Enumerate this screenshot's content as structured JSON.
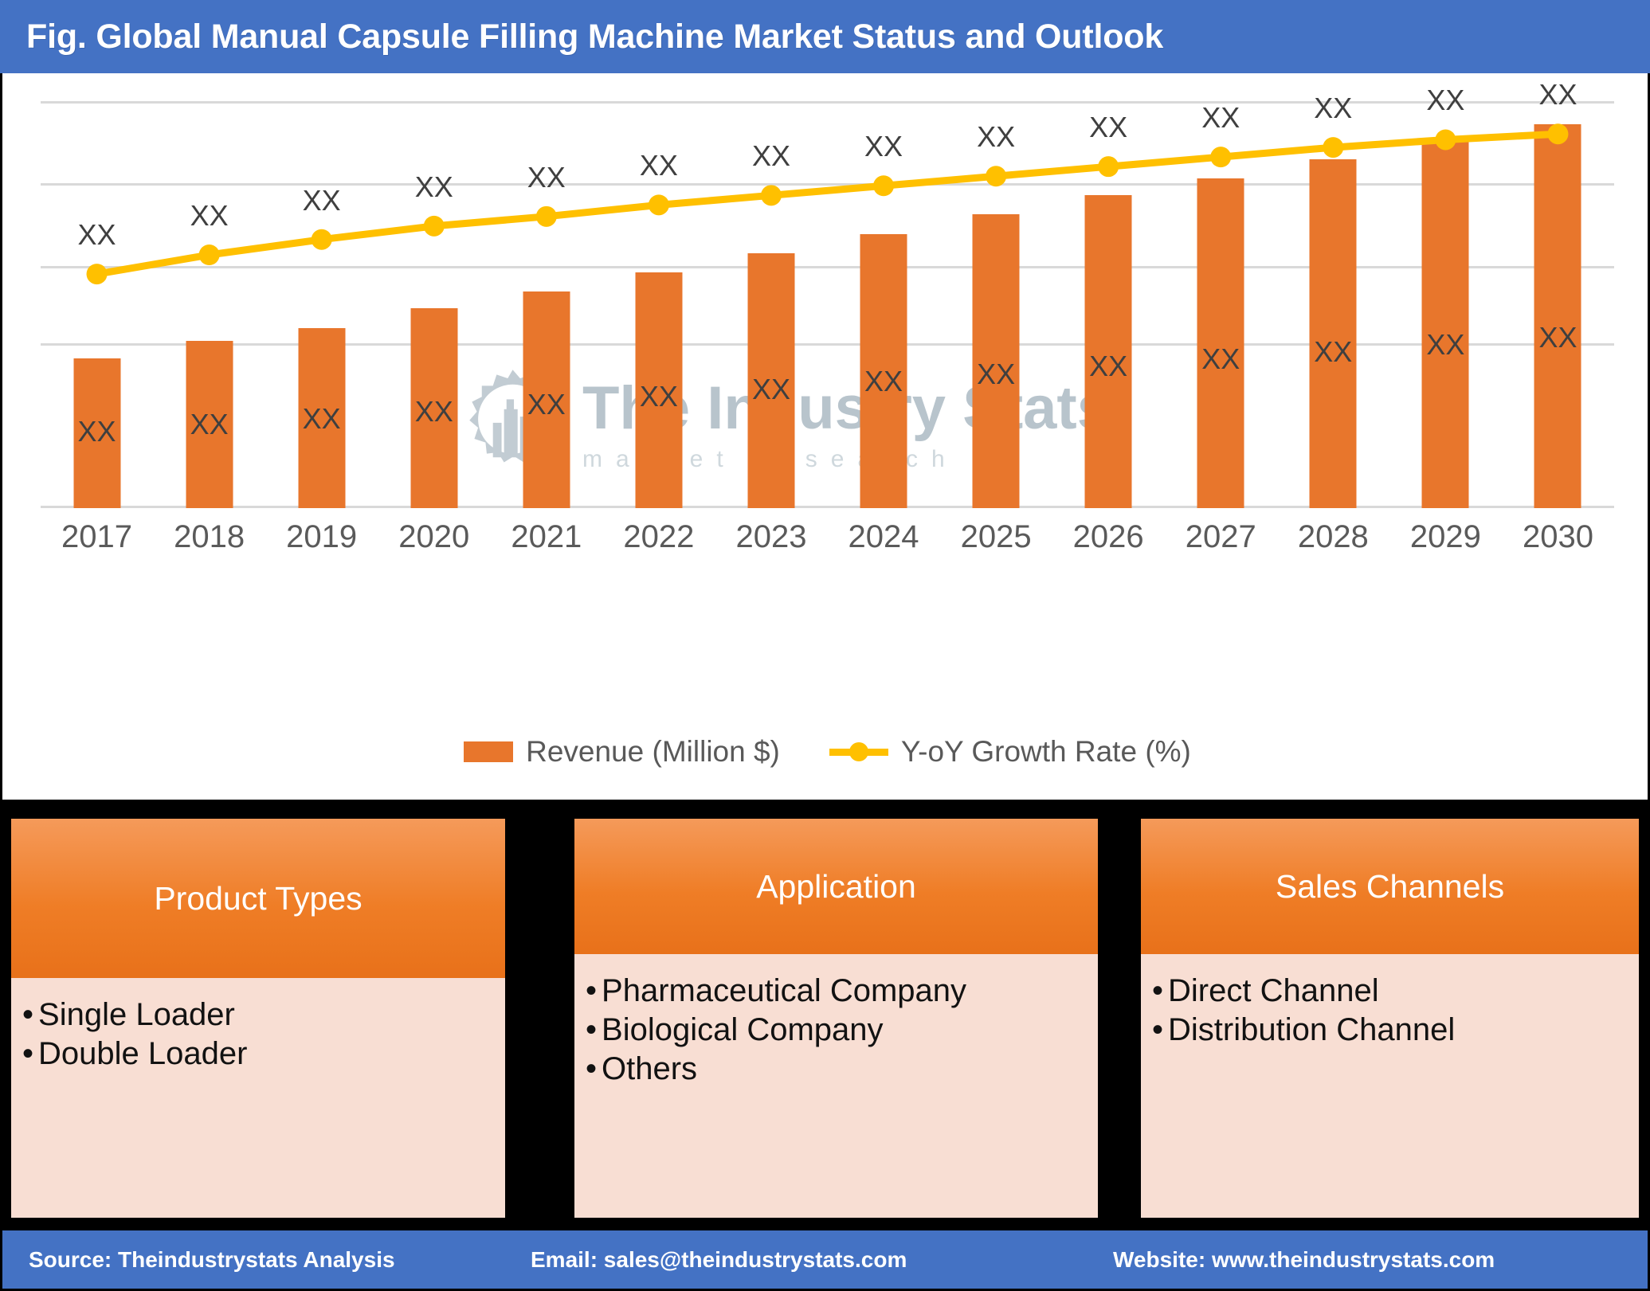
{
  "header": {
    "title": "Fig. Global Manual Capsule Filling Machine Market Status and Outlook",
    "bar_color": "#4472C4"
  },
  "chart_data": {
    "type": "bar",
    "title": "Fig. Global Manual Capsule Filling Machine Market Status and Outlook",
    "xlabel": "",
    "ylabel": "",
    "grid": true,
    "legend_position": "bottom",
    "categories": [
      "2017",
      "2018",
      "2019",
      "2020",
      "2021",
      "2022",
      "2023",
      "2024",
      "2025",
      "2026",
      "2027",
      "2028",
      "2029",
      "2030"
    ],
    "series": [
      {
        "name": "Revenue (Million $)",
        "type": "bar",
        "color": "#E8762C",
        "values": [
          39.0,
          43.5,
          47.0,
          52.0,
          56.5,
          61.5,
          66.5,
          71.5,
          76.5,
          81.5,
          86.0,
          91.0,
          95.5,
          100.0
        ],
        "point_labels": [
          "XX",
          "XX",
          "XX",
          "XX",
          "XX",
          "XX",
          "XX",
          "XX",
          "XX",
          "XX",
          "XX",
          "XX",
          "XX",
          "XX"
        ]
      },
      {
        "name": "Y-oY Growth Rate (%)",
        "type": "line",
        "color": "#FFC000",
        "values": [
          61.0,
          66.0,
          70.0,
          73.5,
          76.0,
          79.0,
          81.5,
          84.0,
          86.5,
          89.0,
          91.5,
          94.0,
          96.0,
          97.5
        ],
        "point_labels": [
          "XX",
          "XX",
          "XX",
          "XX",
          "XX",
          "XX",
          "XX",
          "XX",
          "XX",
          "XX",
          "XX",
          "XX",
          "XX",
          "XX"
        ]
      }
    ],
    "ylim": [
      0,
      110
    ],
    "gridline_values": [
      103.5,
      84.0,
      64.5,
      45.0,
      0
    ],
    "axis_tick_labels": [
      "2017",
      "2018",
      "2019",
      "2020",
      "2021",
      "2022",
      "2023",
      "2024",
      "2025",
      "2026",
      "2027",
      "2028",
      "2029",
      "2030"
    ],
    "note": "Values are obfuscated in the source figure; every data label is rendered as the placeholder 'XX'."
  },
  "legend": {
    "items": [
      {
        "label": "Revenue (Million $)",
        "marker": "square",
        "color": "#E8762C"
      },
      {
        "label": "Y-oY Growth Rate (%)",
        "marker": "line-dot",
        "color": "#FFC000"
      }
    ]
  },
  "watermark": {
    "title": "The Industry Stats",
    "subtitle": "market research",
    "logo_name": "gear-wrench-factory-logo"
  },
  "cards": [
    {
      "title": "Product Types",
      "items": [
        "Single Loader",
        "Double Loader"
      ]
    },
    {
      "title": "Application",
      "items": [
        "Pharmaceutical Company",
        "Biological Company",
        "Others"
      ]
    },
    {
      "title": "Sales Channels",
      "items": [
        "Direct Channel",
        "Distribution Channel"
      ]
    }
  ],
  "footer": {
    "source": "Source: Theindustrystats Analysis",
    "email": "Email: sales@theindustrystats.com",
    "website": "Website: www.theindustrystats.com",
    "bar_color": "#4472C4"
  }
}
